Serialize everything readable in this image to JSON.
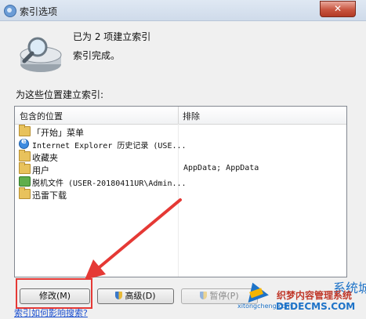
{
  "window": {
    "title": "索引选项",
    "close_label": "✕"
  },
  "status": {
    "line1": "已为 2 项建立索引",
    "line2": "索引完成。"
  },
  "section_label": "为这些位置建立索引:",
  "table": {
    "columns": [
      "包含的位置",
      "排除"
    ],
    "rows": [
      {
        "icon": "folder-icon",
        "name": "「开始」菜单",
        "exclude": ""
      },
      {
        "icon": "ie-icon",
        "name": "Internet Explorer 历史记录 (USE...",
        "exclude": ""
      },
      {
        "icon": "folder-icon",
        "name": "收藏夹",
        "exclude": ""
      },
      {
        "icon": "folder-icon",
        "name": "用户",
        "exclude": "AppData; AppData"
      },
      {
        "icon": "offline-files-icon",
        "name": "脱机文件 (USER-20180411UR\\Admin...",
        "exclude": ""
      },
      {
        "icon": "folder-icon",
        "name": "迅雷下载",
        "exclude": ""
      }
    ]
  },
  "buttons": {
    "modify": "修改(M)",
    "advanced": "高级(D)",
    "pause": "暂停(P)"
  },
  "link": "索引如何影响搜索?",
  "watermark": {
    "line1": "织梦内容管理系统",
    "line2": "DEDECMS.COM",
    "brand": "系统城",
    "url": "xitongcheng.com"
  },
  "colors": {
    "annotation": "#e53935",
    "link": "#1a4fd0",
    "close": "#c8553f"
  }
}
